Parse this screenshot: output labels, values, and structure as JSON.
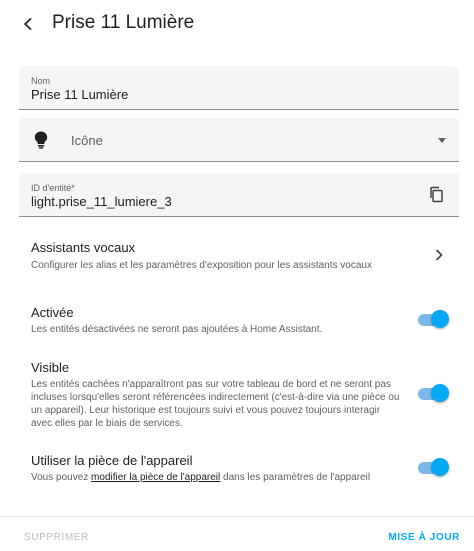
{
  "header": {
    "title": "Prise 11 Lumière"
  },
  "form": {
    "name_label": "Nom",
    "name_value": "Prise 11 Lumière",
    "icon_placeholder": "Icône",
    "entity_id_label": "ID d'entité*",
    "entity_id_value": "light.prise_11_lumiere_3"
  },
  "voice_assistants": {
    "title": "Assistants vocaux",
    "description": "Configurer les alias et les paramètres d'exposition pour les assistants vocaux"
  },
  "enabled": {
    "title": "Activée",
    "description": "Les entités désactivées ne seront pas ajoutées à Home Assistant.",
    "on": true
  },
  "visible": {
    "title": "Visible",
    "description": "Les entités cachées n'apparaîtront pas sur votre tableau de bord et ne seront pas incluses lorsqu'elles seront référencées indirectement (c'est-à-dire via une pièce ou un appareil). Leur historique est toujours suivi et vous pouvez toujours interagir avec elles par le biais de services.",
    "on": true
  },
  "device_area": {
    "title": "Utiliser la pièce de l'appareil",
    "desc_prefix": "Vous pouvez ",
    "desc_link": "modifier la pièce de l'appareil",
    "desc_suffix": " dans les paramètres de l'appareil",
    "on": true
  },
  "footer": {
    "delete_label": "SUPPRIMER",
    "update_label": "MISE À JOUR"
  },
  "colors": {
    "accent": "#03a9f4",
    "field_background": "#f5f5f5",
    "disabled_text": "#bdbdbd"
  },
  "icons": {
    "back": "arrow-left-icon",
    "field_icon": "lightbulb-icon",
    "dropdown": "caret-down-icon",
    "copy": "copy-icon",
    "chevron": "chevron-right-icon"
  }
}
